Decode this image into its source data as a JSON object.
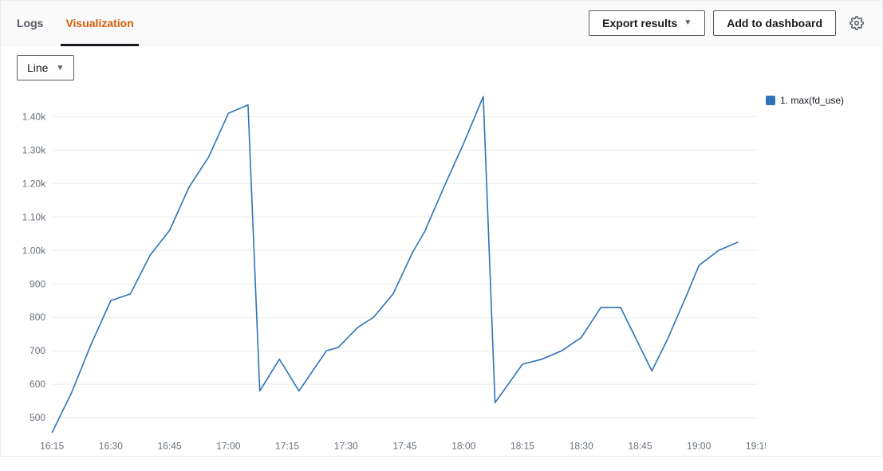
{
  "tabs": {
    "logs": "Logs",
    "visualization": "Visualization"
  },
  "buttons": {
    "export": "Export results",
    "add_dashboard": "Add to dashboard"
  },
  "chart_type_selector": {
    "value": "Line"
  },
  "legend": {
    "series1": "1. max(fd_use)"
  },
  "colors": {
    "series": "#2e73b8",
    "axis_text": "#687078",
    "grid": "#e9ebed",
    "accent": "#d45b07"
  },
  "chart_data": {
    "type": "line",
    "title": "",
    "xlabel": "",
    "ylabel": "",
    "ylim": [
      450,
      1460
    ],
    "y_ticks": [
      500,
      600,
      700,
      800,
      900,
      "1.00k",
      "1.10k",
      "1.20k",
      "1.30k",
      "1.40k"
    ],
    "x_ticks": [
      "16:15",
      "16:30",
      "16:45",
      "17:00",
      "17:15",
      "17:30",
      "17:45",
      "18:00",
      "18:15",
      "18:30",
      "18:45",
      "19:00",
      "19:15"
    ],
    "x_range_minutes": [
      975,
      1155
    ],
    "series": [
      {
        "name": "1. max(fd_use)",
        "points": [
          {
            "t": "16:15",
            "v": 455
          },
          {
            "t": "16:20",
            "v": 575
          },
          {
            "t": "16:25",
            "v": 720
          },
          {
            "t": "16:30",
            "v": 850
          },
          {
            "t": "16:35",
            "v": 870
          },
          {
            "t": "16:40",
            "v": 985
          },
          {
            "t": "16:45",
            "v": 1060
          },
          {
            "t": "16:50",
            "v": 1190
          },
          {
            "t": "16:55",
            "v": 1280
          },
          {
            "t": "17:00",
            "v": 1410
          },
          {
            "t": "17:05",
            "v": 1435
          },
          {
            "t": "17:08",
            "v": 580
          },
          {
            "t": "17:13",
            "v": 675
          },
          {
            "t": "17:18",
            "v": 580
          },
          {
            "t": "17:25",
            "v": 700
          },
          {
            "t": "17:28",
            "v": 710
          },
          {
            "t": "17:33",
            "v": 770
          },
          {
            "t": "17:37",
            "v": 800
          },
          {
            "t": "17:42",
            "v": 870
          },
          {
            "t": "17:47",
            "v": 995
          },
          {
            "t": "17:50",
            "v": 1055
          },
          {
            "t": "17:55",
            "v": 1190
          },
          {
            "t": "18:00",
            "v": 1320
          },
          {
            "t": "18:05",
            "v": 1460
          },
          {
            "t": "18:08",
            "v": 545
          },
          {
            "t": "18:15",
            "v": 660
          },
          {
            "t": "18:20",
            "v": 675
          },
          {
            "t": "18:25",
            "v": 700
          },
          {
            "t": "18:30",
            "v": 740
          },
          {
            "t": "18:35",
            "v": 830
          },
          {
            "t": "18:40",
            "v": 830
          },
          {
            "t": "18:48",
            "v": 640
          },
          {
            "t": "18:52",
            "v": 735
          },
          {
            "t": "18:57",
            "v": 870
          },
          {
            "t": "19:00",
            "v": 955
          },
          {
            "t": "19:05",
            "v": 1000
          },
          {
            "t": "19:10",
            "v": 1025
          }
        ]
      }
    ]
  }
}
